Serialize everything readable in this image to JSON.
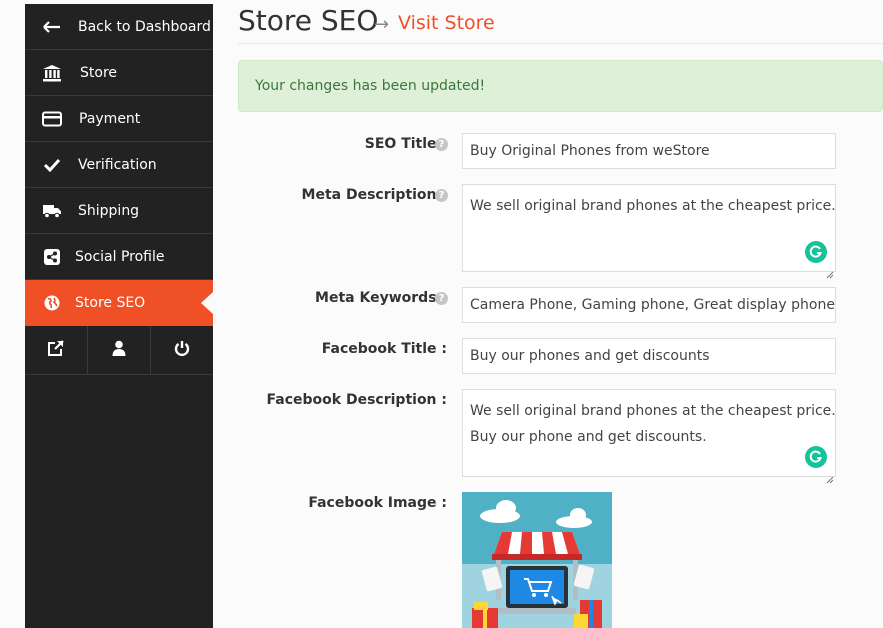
{
  "sidebar": {
    "items": [
      {
        "label": "Back to Dashboard",
        "icon": "arrow-left-icon"
      },
      {
        "label": "Store",
        "icon": "bank-icon"
      },
      {
        "label": "Payment",
        "icon": "credit-card-icon"
      },
      {
        "label": "Verification",
        "icon": "check-icon"
      },
      {
        "label": "Shipping",
        "icon": "truck-icon"
      },
      {
        "label": "Social Profile",
        "icon": "share-icon"
      },
      {
        "label": "Store SEO",
        "icon": "globe-icon",
        "active": true
      }
    ],
    "bottom_icons": [
      "external-link-icon",
      "user-icon",
      "power-icon"
    ]
  },
  "header": {
    "title": "Store SEO",
    "arrow": "→",
    "visit_link": "Visit Store"
  },
  "alert": {
    "message": "Your changes has been updated!"
  },
  "form": {
    "seo_title": {
      "label": "SEO Title :",
      "value": "Buy Original Phones from weStore"
    },
    "meta_description": {
      "label": "Meta Description :",
      "value": "We sell original brand phones at the cheapest price."
    },
    "meta_keywords": {
      "label": "Meta Keywords :",
      "value": "Camera Phone, Gaming phone, Great display phone, phone"
    },
    "facebook_title": {
      "label": "Facebook Title :",
      "value": "Buy our phones and get discounts"
    },
    "facebook_description": {
      "label": "Facebook Description :",
      "line1": "We sell original brand phones at the cheapest price.",
      "line2": "Buy our phone and get discounts."
    },
    "facebook_image": {
      "label": "Facebook Image :"
    }
  },
  "colors": {
    "accent": "#f05025",
    "sidebar_bg": "#222222",
    "alert_bg": "#dff0d8",
    "alert_text": "#3c763d",
    "grammarly": "#15c39a"
  }
}
